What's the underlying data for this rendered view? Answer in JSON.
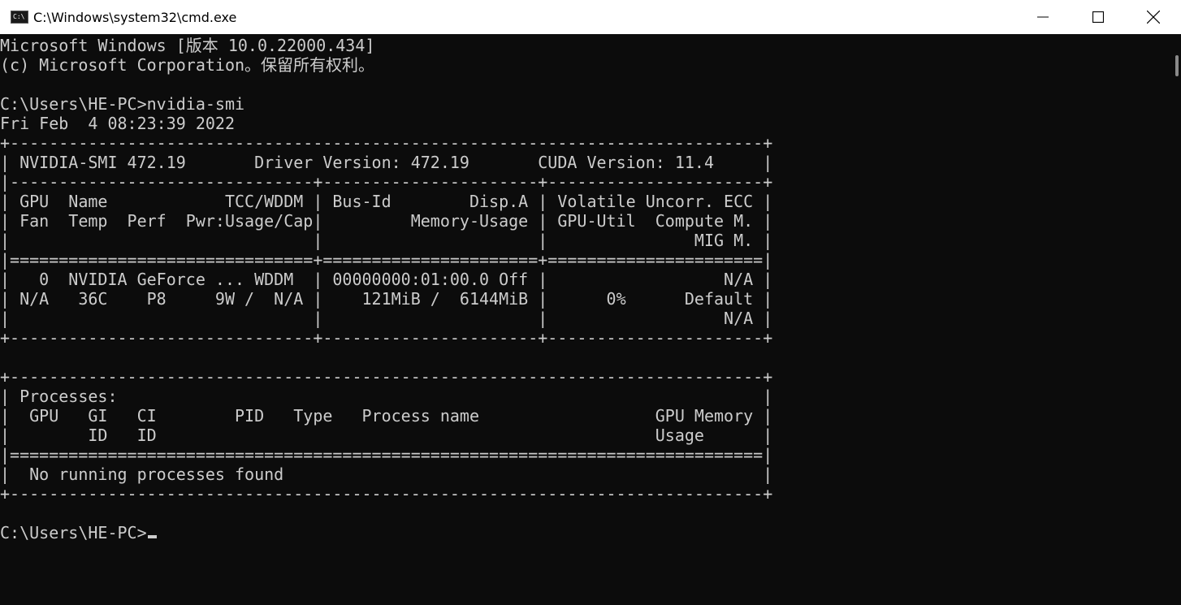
{
  "window": {
    "title": "C:\\Windows\\system32\\cmd.exe",
    "icon": "cmd-icon",
    "icon_text": "C:\\",
    "controls": {
      "minimize": "minimize-icon",
      "maximize": "maximize-icon",
      "close": "close-icon"
    }
  },
  "console": {
    "lines": [
      "Microsoft Windows [版本 10.0.22000.434]",
      "(c) Microsoft Corporation。保留所有权利。",
      "",
      "C:\\Users\\HE-PC>nvidia-smi",
      "Fri Feb  4 08:23:39 2022",
      "+-----------------------------------------------------------------------------+",
      "| NVIDIA-SMI 472.19       Driver Version: 472.19       CUDA Version: 11.4     |",
      "|-------------------------------+----------------------+----------------------+",
      "| GPU  Name            TCC/WDDM | Bus-Id        Disp.A | Volatile Uncorr. ECC |",
      "| Fan  Temp  Perf  Pwr:Usage/Cap|         Memory-Usage | GPU-Util  Compute M. |",
      "|                               |                      |               MIG M. |",
      "|===============================+======================+======================|",
      "|   0  NVIDIA GeForce ... WDDM  | 00000000:01:00.0 Off |                  N/A |",
      "| N/A   36C    P8     9W /  N/A |    121MiB /  6144MiB |      0%      Default |",
      "|                               |                      |                  N/A |",
      "+-------------------------------+----------------------+----------------------+",
      "",
      "+-----------------------------------------------------------------------------+",
      "| Processes:                                                                  |",
      "|  GPU   GI   CI        PID   Type   Process name                  GPU Memory |",
      "|        ID   ID                                                   Usage      |",
      "|=============================================================================|",
      "|  No running processes found                                                 |",
      "+-----------------------------------------------------------------------------+",
      "",
      "C:\\Users\\HE-PC>"
    ]
  },
  "colors": {
    "background": "#0c0c0c",
    "foreground": "#cccccc",
    "titlebar": "#ffffff"
  }
}
